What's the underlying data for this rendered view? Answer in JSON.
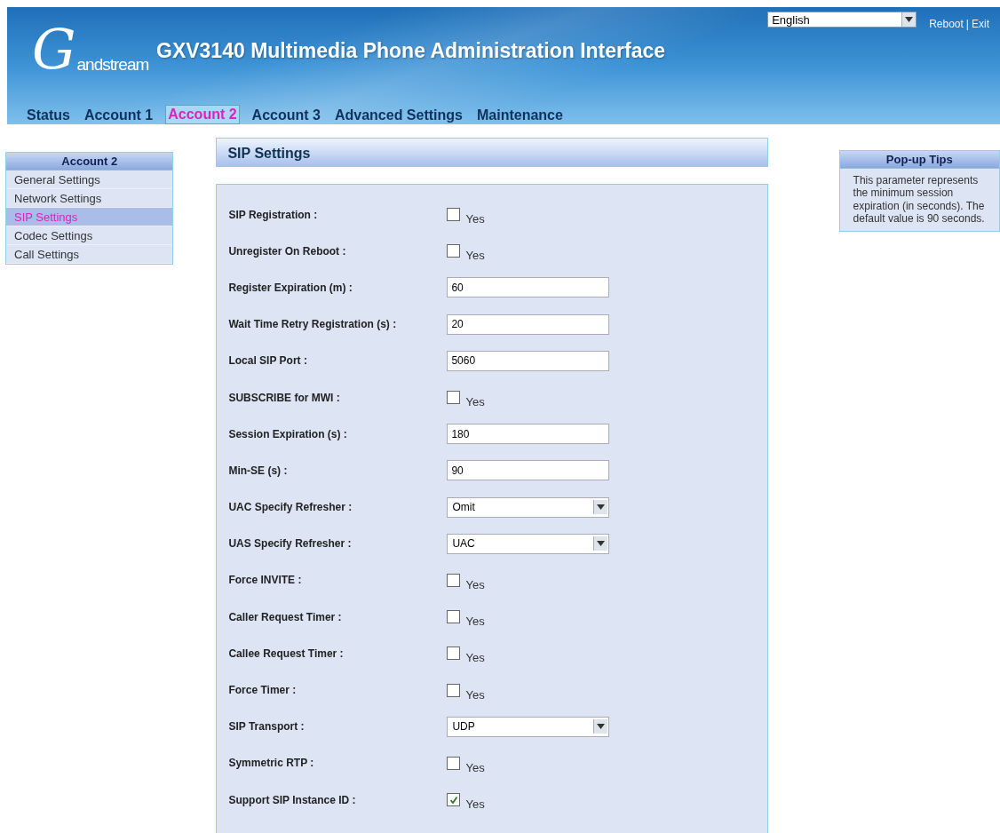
{
  "header": {
    "logo": {
      "letter": "G",
      "word": "andstream"
    },
    "title": "GXV3140 Multimedia Phone Administration Interface",
    "language": "English",
    "links": [
      "Reboot",
      "Exit"
    ],
    "link_separator": "|"
  },
  "tabs": [
    {
      "label": "Status",
      "selected": false
    },
    {
      "label": "Account 1",
      "selected": false
    },
    {
      "label": "Account 2",
      "selected": true
    },
    {
      "label": "Account 3",
      "selected": false
    },
    {
      "label": "Advanced Settings",
      "selected": false
    },
    {
      "label": "Maintenance",
      "selected": false
    }
  ],
  "sidebar": {
    "title": "Account 2",
    "items": [
      {
        "label": "General Settings",
        "selected": false
      },
      {
        "label": "Network Settings",
        "selected": false
      },
      {
        "label": "SIP Settings",
        "selected": true
      },
      {
        "label": "Codec Settings",
        "selected": false
      },
      {
        "label": "Call Settings",
        "selected": false
      }
    ]
  },
  "section_title": "SIP Settings",
  "fields": [
    {
      "kind": "checkbox",
      "label": "SIP Registration :",
      "option": "Yes",
      "checked": false
    },
    {
      "kind": "checkbox",
      "label": "Unregister On Reboot :",
      "option": "Yes",
      "checked": false
    },
    {
      "kind": "text",
      "label": "Register Expiration (m) :",
      "value": "60"
    },
    {
      "kind": "text",
      "label": "Wait Time Retry Registration (s) :",
      "value": "20"
    },
    {
      "kind": "text",
      "label": "Local SIP Port :",
      "value": "5060"
    },
    {
      "kind": "checkbox",
      "label": "SUBSCRIBE for MWI :",
      "option": "Yes",
      "checked": false
    },
    {
      "kind": "text",
      "label": "Session Expiration (s) :",
      "value": "180"
    },
    {
      "kind": "text",
      "label": "Min-SE (s) :",
      "value": "90"
    },
    {
      "kind": "select",
      "label": "UAC Specify Refresher :",
      "value": "Omit"
    },
    {
      "kind": "select",
      "label": "UAS Specify Refresher :",
      "value": "UAC"
    },
    {
      "kind": "checkbox",
      "label": "Force INVITE :",
      "option": "Yes",
      "checked": false
    },
    {
      "kind": "checkbox",
      "label": "Caller Request Timer :",
      "option": "Yes",
      "checked": false
    },
    {
      "kind": "checkbox",
      "label": "Callee Request Timer :",
      "option": "Yes",
      "checked": false
    },
    {
      "kind": "checkbox",
      "label": "Force Timer :",
      "option": "Yes",
      "checked": false
    },
    {
      "kind": "select",
      "label": "SIP Transport :",
      "value": "UDP"
    },
    {
      "kind": "checkbox",
      "label": "Symmetric RTP :",
      "option": "Yes",
      "checked": false
    },
    {
      "kind": "checkbox",
      "label": "Support SIP Instance ID :",
      "option": "Yes",
      "checked": true
    }
  ],
  "tips": {
    "title": "Pop-up Tips",
    "text": "This parameter represents the minimum session expiration (in seconds). The default value is 90 seconds."
  }
}
